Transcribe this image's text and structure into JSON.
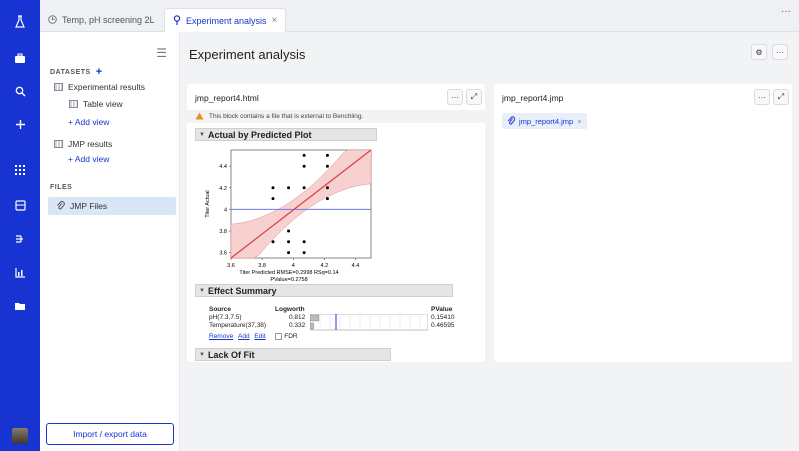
{
  "rail": {
    "icons": [
      "flask-logo-icon",
      "briefcase-icon",
      "search-icon",
      "plus-icon",
      "apps-grid-icon",
      "storage-icon",
      "workflow-icon",
      "bar-chart-icon",
      "folder-icon",
      "avatar"
    ]
  },
  "tabs": [
    {
      "label": "Temp, pH screening 2L",
      "icon": "clock-icon"
    },
    {
      "label": "Experiment analysis",
      "icon": "pin-icon",
      "close": "×"
    }
  ],
  "tab_more": "···",
  "sidebar": {
    "menu_icon": "☰",
    "datasets_label": "DATASETS",
    "datasets_add": "+",
    "items": [
      {
        "label": "Experimental results"
      },
      {
        "label": "Table view"
      },
      {
        "label": "+ Add view"
      },
      {
        "label": "JMP results"
      },
      {
        "label": "+ Add view"
      }
    ],
    "files_label": "FILES",
    "files_item": "JMP Files",
    "import_button": "Import / export data"
  },
  "main": {
    "title": "Experiment analysis",
    "gear": "⚙",
    "more": "···"
  },
  "left_panel": {
    "title": "jmp_report4.html",
    "more": "···",
    "expand": "⤢",
    "warning": "This block contains a file that is external to Benchling.",
    "sections": {
      "actual": "Actual by Predicted Plot",
      "effect": "Effect Summary",
      "lack": "Lack Of Fit"
    },
    "plot": {
      "ylabel": "Titer Actual",
      "caption1": "Titer Predicted RMSE=0.2998 RSq=0.14",
      "caption2": "PValue=0.2758"
    },
    "effect_table": {
      "headers": {
        "source": "Source",
        "logworth": "Logworth",
        "pvalue": "PValue"
      },
      "rows": [
        {
          "source": "pH(7.3,7.5)",
          "logworth": "0.812",
          "pvalue": "0.15410",
          "frac": 0.81
        },
        {
          "source": "Temperature(37,38)",
          "logworth": "0.332",
          "pvalue": "0.46595",
          "frac": 0.33
        }
      ],
      "links": {
        "remove": "Remove",
        "add": "Add",
        "edit": "Edit"
      },
      "fdr": "FDR"
    }
  },
  "right_panel": {
    "title": "jmp_report4.jmp",
    "more": "···",
    "expand": "⤢",
    "chip": "jmp_report4.jmp",
    "chip_close": "×"
  },
  "chart_data": {
    "type": "scatter",
    "xlabel": "Titer Predicted",
    "ylabel": "Titer Actual",
    "xlim": [
      3.6,
      4.5
    ],
    "ylim": [
      3.55,
      4.55
    ],
    "x_ticks": [
      "3.6",
      "3.8",
      "4",
      "4.2",
      "4.4"
    ],
    "y_ticks": [
      "3.6",
      "3.8",
      "4",
      "4.2",
      "4.4"
    ],
    "x_tick_values": [
      3.6,
      3.8,
      4.0,
      4.2,
      4.4
    ],
    "y_tick_values": [
      3.6,
      3.8,
      4.0,
      4.2,
      4.4
    ],
    "points": [
      [
        4.07,
        4.5
      ],
      [
        4.07,
        4.4
      ],
      [
        4.22,
        4.5
      ],
      [
        4.22,
        4.4
      ],
      [
        3.87,
        4.2
      ],
      [
        3.97,
        4.2
      ],
      [
        4.07,
        4.2
      ],
      [
        4.22,
        4.2
      ],
      [
        3.87,
        4.1
      ],
      [
        4.22,
        4.1
      ],
      [
        3.97,
        3.8
      ],
      [
        3.87,
        3.7
      ],
      [
        3.97,
        3.7
      ],
      [
        4.07,
        3.7
      ],
      [
        3.97,
        3.6
      ],
      [
        4.07,
        3.6
      ]
    ],
    "fit_line": [
      [
        3.6,
        3.55
      ],
      [
        4.5,
        4.55
      ]
    ],
    "mean_line": 4.0,
    "colors": {
      "fit": "#e03b3b",
      "band": "#f7d0d0",
      "mean": "#6b7de0",
      "points": "#000000"
    }
  }
}
